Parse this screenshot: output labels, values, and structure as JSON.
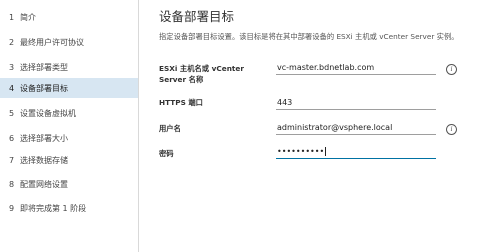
{
  "sidebar": {
    "steps": [
      {
        "num": "1",
        "label": "简介"
      },
      {
        "num": "2",
        "label": "最终用户许可协议"
      },
      {
        "num": "3",
        "label": "选择部署类型"
      },
      {
        "num": "4",
        "label": "设备部署目标"
      },
      {
        "num": "5",
        "label": "设置设备虚拟机"
      },
      {
        "num": "6",
        "label": "选择部署大小"
      },
      {
        "num": "7",
        "label": "选择数据存储"
      },
      {
        "num": "8",
        "label": "配置网络设置"
      },
      {
        "num": "9",
        "label": "即将完成第 1 阶段"
      }
    ],
    "active_step": "4"
  },
  "main": {
    "title": "设备部署目标",
    "description": "指定设备部署目标设置。该目标是将在其中部署设备的 ESXi 主机或 vCenter Server 实例。",
    "fields": {
      "host": {
        "label": "ESXi 主机名或 vCenter Server 名称",
        "value": "vc-master.bdnetlab.com",
        "info_icon": "info-icon"
      },
      "port": {
        "label": "HTTPS 端口",
        "value": "443"
      },
      "username": {
        "label": "用户名",
        "value": "administrator@vsphere.local",
        "info_icon": "info-icon"
      },
      "password": {
        "label": "密码",
        "value": "••••••••••"
      }
    }
  },
  "colors": {
    "active_step_bg": "#d7e6f2",
    "focus_underline": "#0072a3"
  }
}
